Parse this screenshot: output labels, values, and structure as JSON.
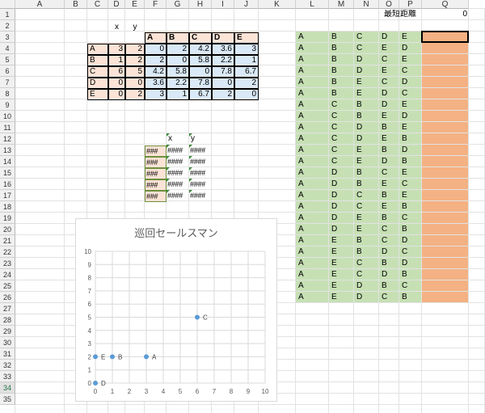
{
  "columns": [
    "A",
    "B",
    "C",
    "D",
    "E",
    "F",
    "G",
    "H",
    "I",
    "J",
    "K",
    "L",
    "M",
    "N",
    "O",
    "P",
    "Q"
  ],
  "rows": [
    "1",
    "2",
    "3",
    "4",
    "5",
    "6",
    "7",
    "8",
    "9",
    "10",
    "11",
    "12",
    "13",
    "14",
    "15",
    "16",
    "17",
    "18",
    "19",
    "20",
    "21",
    "22",
    "23",
    "24",
    "25",
    "26",
    "27",
    "28",
    "29",
    "30",
    "31",
    "32",
    "33",
    "34",
    "35"
  ],
  "coord_table": {
    "x_label": "x",
    "y_label": "y",
    "names": [
      "A",
      "B",
      "C",
      "D",
      "E"
    ],
    "x": [
      "3",
      "1",
      "6",
      "0",
      "0"
    ],
    "y": [
      "2",
      "2",
      "5",
      "0",
      "2"
    ]
  },
  "distance_matrix": {
    "headers": [
      "A",
      "B",
      "C",
      "D",
      "E"
    ],
    "rows": [
      [
        "0",
        "2",
        "4.2",
        "3.6",
        "3"
      ],
      [
        "2",
        "0",
        "5.8",
        "2.2",
        "1"
      ],
      [
        "4.2",
        "5.8",
        "0",
        "7.8",
        "6.7"
      ],
      [
        "3.6",
        "2.2",
        "7.8",
        "0",
        "2"
      ],
      [
        "3",
        "1",
        "6.7",
        "2",
        "0"
      ]
    ]
  },
  "small_table": {
    "x_label": "x",
    "y_label": "y",
    "hash_short": "###",
    "hash_long": "####",
    "count": 5
  },
  "shortest": {
    "label": "最短距離",
    "value": "0"
  },
  "permutations": [
    [
      "A",
      "B",
      "C",
      "D",
      "E"
    ],
    [
      "A",
      "B",
      "C",
      "E",
      "D"
    ],
    [
      "A",
      "B",
      "D",
      "C",
      "E"
    ],
    [
      "A",
      "B",
      "D",
      "E",
      "C"
    ],
    [
      "A",
      "B",
      "E",
      "C",
      "D"
    ],
    [
      "A",
      "B",
      "E",
      "D",
      "C"
    ],
    [
      "A",
      "C",
      "B",
      "D",
      "E"
    ],
    [
      "A",
      "C",
      "B",
      "E",
      "D"
    ],
    [
      "A",
      "C",
      "D",
      "B",
      "E"
    ],
    [
      "A",
      "C",
      "D",
      "E",
      "B"
    ],
    [
      "A",
      "C",
      "E",
      "B",
      "D"
    ],
    [
      "A",
      "C",
      "E",
      "D",
      "B"
    ],
    [
      "A",
      "D",
      "B",
      "C",
      "E"
    ],
    [
      "A",
      "D",
      "B",
      "E",
      "C"
    ],
    [
      "A",
      "D",
      "C",
      "B",
      "E"
    ],
    [
      "A",
      "D",
      "C",
      "E",
      "B"
    ],
    [
      "A",
      "D",
      "E",
      "B",
      "C"
    ],
    [
      "A",
      "D",
      "E",
      "C",
      "B"
    ],
    [
      "A",
      "E",
      "B",
      "C",
      "D"
    ],
    [
      "A",
      "E",
      "B",
      "D",
      "C"
    ],
    [
      "A",
      "E",
      "C",
      "B",
      "D"
    ],
    [
      "A",
      "E",
      "C",
      "D",
      "B"
    ],
    [
      "A",
      "E",
      "D",
      "B",
      "C"
    ],
    [
      "A",
      "E",
      "D",
      "C",
      "B"
    ]
  ],
  "colors": {
    "name_fill": "#fbe3d6",
    "header_fill": "#fbe3d6",
    "matrix_fill": "#dae9f7",
    "perm_fill": "#c6e0b4",
    "result_fill": "#f4b183",
    "marker": "#5b9bd5"
  },
  "chart_data": {
    "type": "scatter",
    "title": "巡回セールスマン",
    "xlim": [
      0,
      10
    ],
    "ylim": [
      0,
      10
    ],
    "xticks": [
      "0",
      "1",
      "2",
      "3",
      "4",
      "5",
      "6",
      "7",
      "8",
      "9",
      "10"
    ],
    "yticks": [
      "0",
      "1",
      "2",
      "3",
      "4",
      "5",
      "6",
      "7",
      "8",
      "9",
      "10"
    ],
    "grid": true,
    "points": [
      {
        "label": "A",
        "x": 3,
        "y": 2
      },
      {
        "label": "B",
        "x": 1,
        "y": 2
      },
      {
        "label": "C",
        "x": 6,
        "y": 5
      },
      {
        "label": "D",
        "x": 0,
        "y": 0
      },
      {
        "label": "E",
        "x": 0,
        "y": 2
      }
    ]
  }
}
